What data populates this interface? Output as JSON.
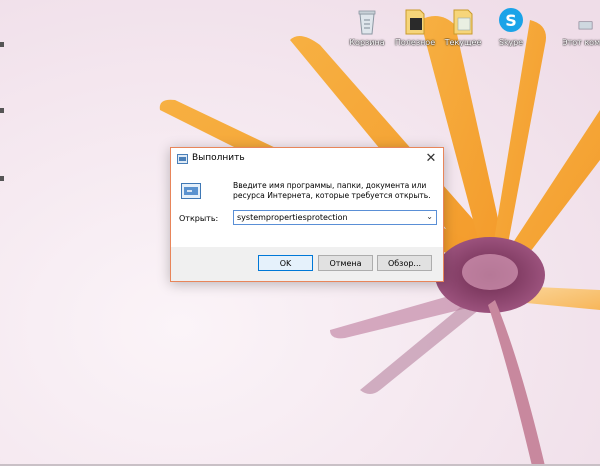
{
  "desktop": {
    "icons": [
      {
        "label": "Корзина",
        "icon": "recycle-bin-icon"
      },
      {
        "label": "Полезное",
        "icon": "folder-icon"
      },
      {
        "label": "Текущее",
        "icon": "folder-icon"
      },
      {
        "label": "Skype",
        "icon": "skype-icon"
      },
      {
        "label": "Этот комп...",
        "icon": "computer-icon"
      }
    ]
  },
  "dialog": {
    "title": "Выполнить",
    "description": "Введите имя программы, папки, документа или ресурса Интернета, которые требуется открыть.",
    "open_label": "Открыть:",
    "open_value": "systempropertiesprotection",
    "ok_label": "OK",
    "cancel_label": "Отмена",
    "browse_label": "Обзор..."
  },
  "colors": {
    "accent_border": "#e8855a",
    "focus_blue": "#0078d7"
  }
}
